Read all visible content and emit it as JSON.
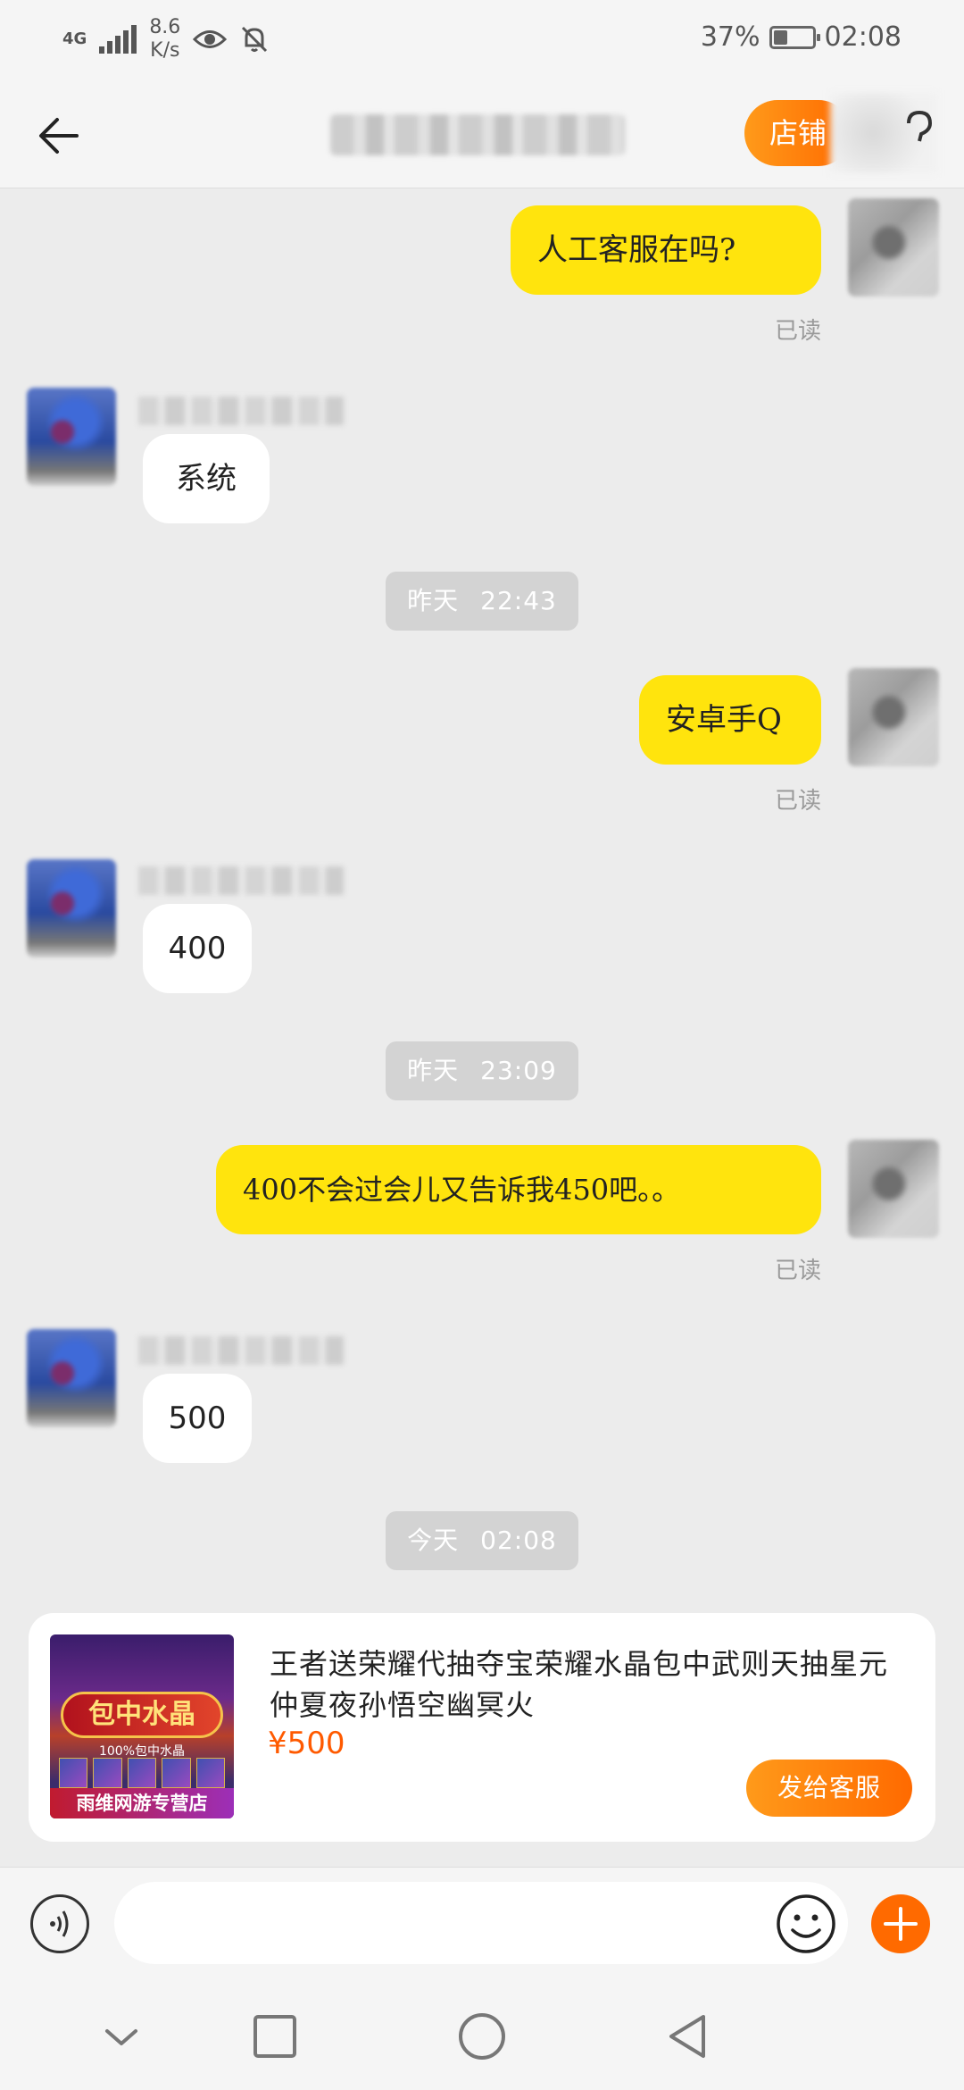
{
  "status_bar": {
    "network": "4G",
    "speed_value": "8.6",
    "speed_unit": "K/s",
    "battery_percent": "37%",
    "battery_level": 0.37,
    "time": "02:08"
  },
  "header": {
    "store_label": "店铺"
  },
  "messages": [
    {
      "text": "人工客服在吗?",
      "read": "已读"
    },
    {
      "text": "系统"
    },
    {
      "time_label": "昨天",
      "time": "22:43"
    },
    {
      "text": "安卓手Q",
      "read": "已读"
    },
    {
      "text": "400"
    },
    {
      "time_label": "昨天",
      "time": "23:09"
    },
    {
      "text": "400不会过会儿又告诉我450吧。。",
      "read": "已读"
    },
    {
      "text": "500"
    },
    {
      "time_label": "今天",
      "time": "02:08"
    }
  ],
  "product": {
    "thumb_banner": "包中水晶",
    "thumb_sub": "100%包中水晶",
    "thumb_shop": "雨维网游专营店",
    "title": "王者送荣耀代抽夺宝荣耀水晶包中武则天抽星元仲夏夜孙悟空幽冥火",
    "price": "¥500",
    "send_label": "发给客服"
  },
  "input": {
    "value": ""
  },
  "icons": {
    "back": "back-arrow-icon",
    "help": "question-icon",
    "voice": "voice-icon",
    "emoji": "emoji-icon",
    "plus": "plus-icon",
    "nav_recent": "chevron-down-icon",
    "nav_overview": "square-icon",
    "nav_home": "circle-icon",
    "nav_back": "triangle-back-icon"
  },
  "colors": {
    "accent": "#ff6a00",
    "my_bubble": "#ffe40d",
    "their_bubble": "#ffffff"
  }
}
